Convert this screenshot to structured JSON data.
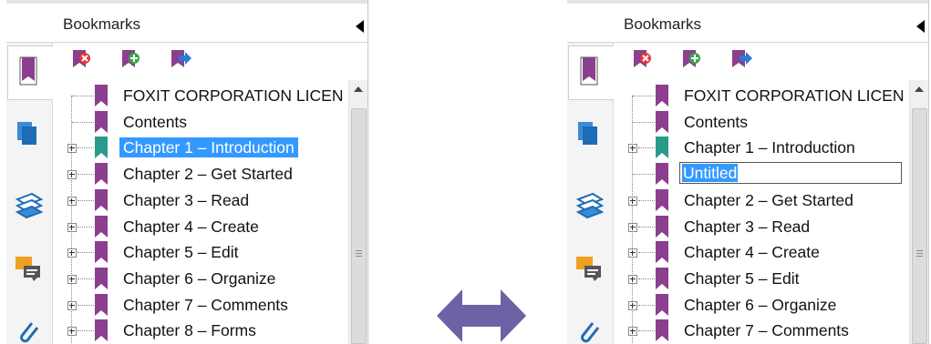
{
  "colors": {
    "selection": "#3399ff",
    "bookmark_purple": "#8b3f8e",
    "bookmark_teal": "#2a9a8c",
    "arrow": "#6e62a5"
  },
  "panels": {
    "left": {
      "header_title": "Bookmarks",
      "items": [
        {
          "label": "FOXIT CORPORATION LICEN",
          "icon": "bookmark-icon-purple",
          "expandable": false
        },
        {
          "label": "Contents",
          "icon": "bookmark-icon-purple",
          "expandable": false
        },
        {
          "label": "Chapter 1 – Introduction",
          "icon": "bookmark-icon-teal",
          "expandable": true,
          "selected": true
        },
        {
          "label": "Chapter 2 – Get Started",
          "icon": "bookmark-icon-purple",
          "expandable": true
        },
        {
          "label": "Chapter 3 – Read",
          "icon": "bookmark-icon-purple",
          "expandable": true
        },
        {
          "label": "Chapter 4 – Create",
          "icon": "bookmark-icon-purple",
          "expandable": true
        },
        {
          "label": "Chapter 5 – Edit",
          "icon": "bookmark-icon-purple",
          "expandable": true
        },
        {
          "label": "Chapter 6 – Organize",
          "icon": "bookmark-icon-purple",
          "expandable": true
        },
        {
          "label": "Chapter 7 – Comments",
          "icon": "bookmark-icon-purple",
          "expandable": true
        },
        {
          "label": "Chapter 8 – Forms",
          "icon": "bookmark-icon-purple",
          "expandable": true
        }
      ]
    },
    "right": {
      "header_title": "Bookmarks",
      "items": [
        {
          "label": "FOXIT CORPORATION LICEN",
          "icon": "bookmark-icon-purple",
          "expandable": false
        },
        {
          "label": "Contents",
          "icon": "bookmark-icon-purple",
          "expandable": false
        },
        {
          "label": "Chapter 1 – Introduction",
          "icon": "bookmark-icon-teal",
          "expandable": true
        },
        {
          "label": "Untitled",
          "icon": "bookmark-icon-purple",
          "expandable": false,
          "editing": true
        },
        {
          "label": "Chapter 2 – Get Started",
          "icon": "bookmark-icon-purple",
          "expandable": true
        },
        {
          "label": "Chapter 3 – Read",
          "icon": "bookmark-icon-purple",
          "expandable": true
        },
        {
          "label": "Chapter 4 – Create",
          "icon": "bookmark-icon-purple",
          "expandable": true
        },
        {
          "label": "Chapter 5 – Edit",
          "icon": "bookmark-icon-purple",
          "expandable": true
        },
        {
          "label": "Chapter 6 – Organize",
          "icon": "bookmark-icon-purple",
          "expandable": true
        },
        {
          "label": "Chapter 7 – Comments",
          "icon": "bookmark-icon-purple",
          "expandable": true
        }
      ]
    }
  },
  "toolbar_icons": [
    "delete-bookmark-icon",
    "add-bookmark-icon",
    "go-to-bookmark-icon"
  ],
  "side_tab_icons": [
    "bookmarks-tab-icon",
    "pages-tab-icon",
    "layers-tab-icon",
    "comments-tab-icon",
    "attachments-tab-icon"
  ],
  "center_icon": "double-arrow-icon"
}
